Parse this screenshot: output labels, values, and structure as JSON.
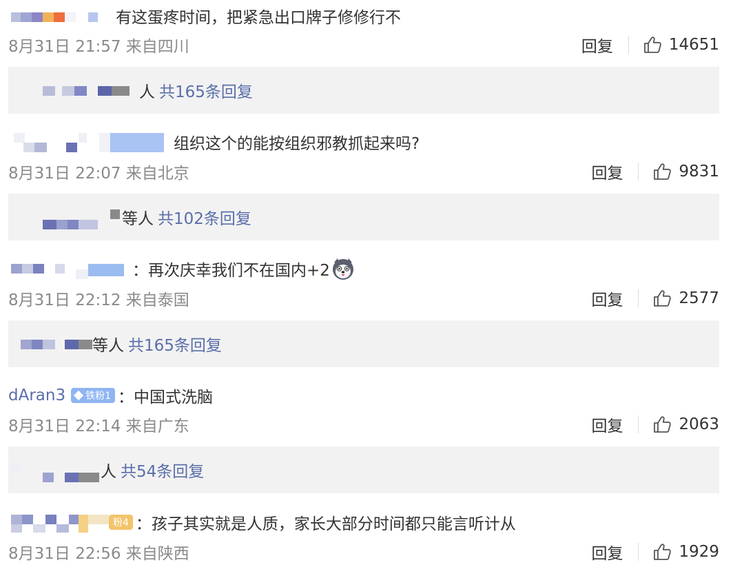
{
  "comments": [
    {
      "text": "有这蛋疼时间，把紧急出口牌子修修行不",
      "time": "8月31日 21:57 来自四川",
      "reply_label": "回复",
      "likes": "14651",
      "replies": {
        "label_prefix": "人",
        "count_text": "共165条回复"
      }
    },
    {
      "text": "组织这个的能按组织邪教抓起来吗?",
      "time": "8月31日 22:07 来自北京",
      "reply_label": "回复",
      "likes": "9831",
      "replies": {
        "label_prefix": "等人",
        "count_text": "共102条回复"
      }
    },
    {
      "text": "：再次庆幸我们不在国内+2",
      "emoji": "husky-emoji",
      "time": "8月31日 22:12 来自泰国",
      "reply_label": "回复",
      "likes": "2577",
      "replies": {
        "label_prefix": "等人",
        "count_text": "共165条回复"
      }
    },
    {
      "username": "dAran3",
      "badge": "铁粉1",
      "text": "：中国式洗脑",
      "time": "8月31日 22:14 来自广东",
      "reply_label": "回复",
      "likes": "2063",
      "replies": {
        "label_prefix": "人",
        "count_text": "共54条回复"
      }
    },
    {
      "badge": "粉4",
      "text": "：孩子其实就是人质，家长大部分时间都只能言听计从",
      "time": "8月31日 22:56 来自陕西",
      "reply_label": "回复",
      "likes": "1929"
    }
  ],
  "colors": {
    "link": "#5a6eaa",
    "meta": "#8a8a8a",
    "reply_bg": "#f2f2f2",
    "badge_blue": "#8fb5f2",
    "badge_orange": "#f2c46b"
  },
  "icons": {
    "like": "thumbs-up-icon"
  }
}
